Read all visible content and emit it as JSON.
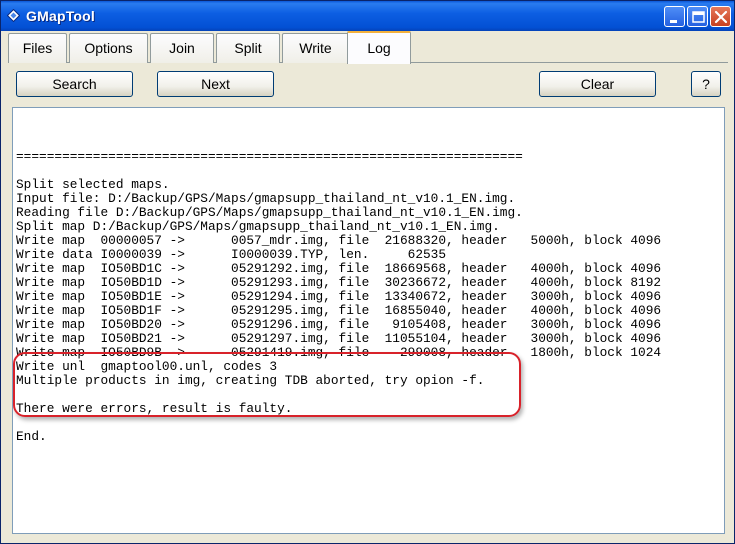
{
  "window": {
    "title": "GMapTool"
  },
  "tabs": [
    {
      "label": "Files"
    },
    {
      "label": "Options"
    },
    {
      "label": "Join"
    },
    {
      "label": "Split"
    },
    {
      "label": "Write"
    },
    {
      "label": "Log",
      "active": true
    }
  ],
  "toolbar": {
    "search_label": "Search",
    "next_label": "Next",
    "clear_label": "Clear",
    "help_label": "?"
  },
  "log": {
    "lines": [
      "",
      "==================================================================",
      "",
      "Split selected maps.",
      "Input file: D:/Backup/GPS/Maps/gmapsupp_thailand_nt_v10.1_EN.img.",
      "Reading file D:/Backup/GPS/Maps/gmapsupp_thailand_nt_v10.1_EN.img.",
      "Split map D:/Backup/GPS/Maps/gmapsupp_thailand_nt_v10.1_EN.img.",
      "Write map  00000057 ->      0057_mdr.img, file  21688320, header   5000h, block 4096",
      "Write data I0000039 ->      I0000039.TYP, len.     62535",
      "Write map  IO50BD1C ->      05291292.img, file  18669568, header   4000h, block 4096",
      "Write map  IO50BD1D ->      05291293.img, file  30236672, header   4000h, block 8192",
      "Write map  IO50BD1E ->      05291294.img, file  13340672, header   3000h, block 4096",
      "Write map  IO50BD1F ->      05291295.img, file  16855040, header   4000h, block 4096",
      "Write map  IO50BD20 ->      05291296.img, file   9105408, header   3000h, block 4096",
      "Write map  IO50BD21 ->      05291297.img, file  11055104, header   3000h, block 4096",
      "Write map  IO50BD9B ->      05291419.img, file    299008, header   1800h, block 1024",
      "Write unl  gmaptool00.unl, codes 3",
      "Multiple products in img, creating TDB aborted, try opion -f.",
      "",
      "There were errors, result is faulty.",
      "",
      "End."
    ]
  },
  "colors": {
    "titlebar": "#0350d4",
    "highlight": "#d8222a",
    "active_tab_accent": "#f3b13c"
  }
}
